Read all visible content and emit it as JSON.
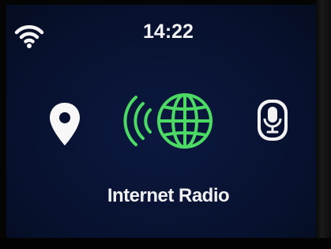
{
  "status_bar": {
    "time": "14:22",
    "wifi_icon": "wifi-icon"
  },
  "modes": [
    {
      "name": "location",
      "icon": "location-pin-icon",
      "selected": false
    },
    {
      "name": "internet-radio",
      "icon": "globe-radio-waves-icon",
      "selected": true
    },
    {
      "name": "microphone",
      "icon": "microphone-icon",
      "selected": false
    }
  ],
  "selected_mode_label": "Internet Radio",
  "colors": {
    "background": "#081230",
    "accent": "#4cd964",
    "text": "#f0f0f0",
    "inactive_icon": "#ffffff"
  }
}
